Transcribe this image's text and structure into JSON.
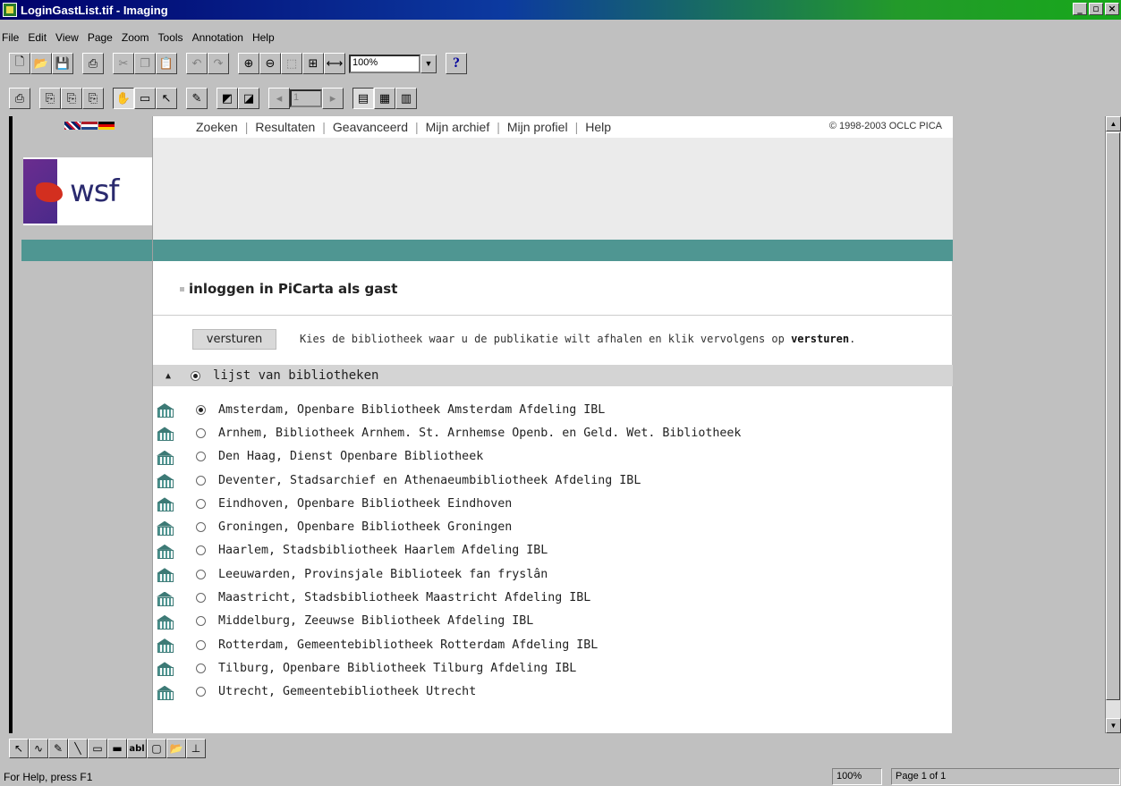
{
  "window": {
    "title": "LoginGastList.tif - Imaging",
    "controls": [
      "_",
      "▫",
      "×"
    ]
  },
  "menu": [
    "File",
    "Edit",
    "View",
    "Page",
    "Zoom",
    "Tools",
    "Annotation",
    "Help"
  ],
  "toolbar": {
    "zoom_value": "100%",
    "page_field": "1"
  },
  "document": {
    "nav_links": [
      "Zoeken",
      "Resultaten",
      "Geavanceerd",
      "Mijn archief",
      "Mijn profiel",
      "Help"
    ],
    "copyright": "© 1998-2003 OCLC PICA",
    "logo_text": "wsf",
    "heading": "inloggen in PiCarta als gast",
    "send_button": "versturen",
    "instruction_prefix": "Kies de bibliotheek waar u de publikatie wilt afhalen en klik vervolgens op ",
    "instruction_bold": "versturen",
    "instruction_suffix": ".",
    "list_header": "lijst van bibliotheken",
    "libraries": [
      {
        "name": "Amsterdam, Openbare Bibliotheek Amsterdam Afdeling IBL",
        "selected": true
      },
      {
        "name": "Arnhem, Bibliotheek Arnhem. St. Arnhemse Openb. en Geld. Wet. Bibliotheek",
        "selected": false
      },
      {
        "name": "Den Haag, Dienst Openbare Bibliotheek",
        "selected": false
      },
      {
        "name": "Deventer, Stadsarchief en Athenaeumbibliotheek Afdeling IBL",
        "selected": false
      },
      {
        "name": "Eindhoven, Openbare Bibliotheek Eindhoven",
        "selected": false
      },
      {
        "name": "Groningen, Openbare Bibliotheek Groningen",
        "selected": false
      },
      {
        "name": "Haarlem, Stadsbibliotheek Haarlem Afdeling IBL",
        "selected": false
      },
      {
        "name": "Leeuwarden, Provinsjale Biblioteek fan fryslân",
        "selected": false
      },
      {
        "name": "Maastricht, Stadsbibliotheek Maastricht Afdeling IBL",
        "selected": false
      },
      {
        "name": "Middelburg, Zeeuwse Bibliotheek Afdeling IBL",
        "selected": false
      },
      {
        "name": "Rotterdam, Gemeentebibliotheek Rotterdam Afdeling IBL",
        "selected": false
      },
      {
        "name": "Tilburg, Openbare Bibliotheek Tilburg Afdeling IBL",
        "selected": false
      },
      {
        "name": "Utrecht, Gemeentebibliotheek Utrecht",
        "selected": false
      }
    ]
  },
  "annotation_tools": [
    "abl"
  ],
  "status": {
    "help_text": "For Help, press F1",
    "zoom": "100%",
    "page": "Page 1 of 1"
  },
  "colors": {
    "teal": "#4f9692",
    "title_gradient_start": "#00006b",
    "title_gradient_end": "#17a81b"
  }
}
